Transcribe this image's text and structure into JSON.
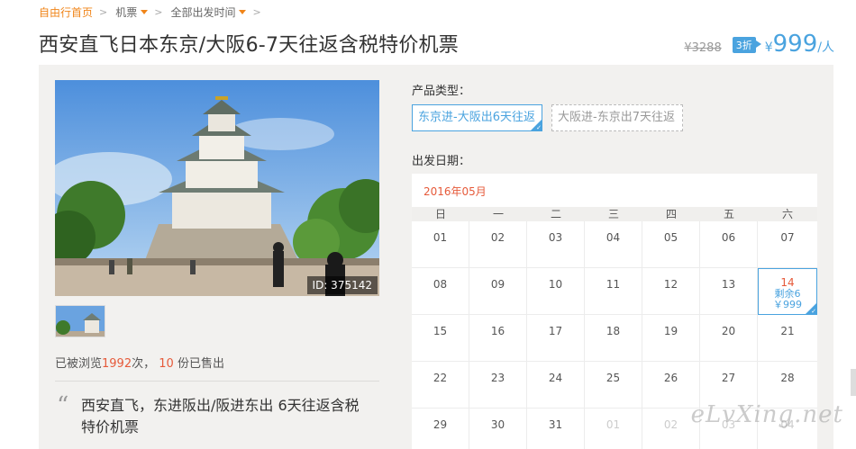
{
  "breadcrumb": {
    "home": "自由行首页",
    "category": "机票",
    "departure_time": "全部出发时间",
    "separator": ">"
  },
  "title": "西安直飞日本东京/大阪6-7天往返含税特价机票",
  "price": {
    "original": "¥3288",
    "discount": "3折",
    "currency": "¥",
    "amount": "999",
    "unit": "/人"
  },
  "gallery": {
    "photo_id": "ID: 375142"
  },
  "stats": {
    "prefix": "已被浏览",
    "views": "1992",
    "mid": "次，",
    "sold": "10",
    "suffix": "份已售出"
  },
  "summary": "西安直飞，东进阪出/阪进东出 6天往返含税特价机票",
  "product_type": {
    "label": "产品类型：",
    "options": [
      {
        "label": "东京进-大阪出6天往返",
        "selected": true
      },
      {
        "label": "大阪进-东京出7天往返",
        "selected": false
      }
    ]
  },
  "departure": {
    "label": "出发日期："
  },
  "calendar": {
    "month": "2016年05月",
    "weekdays": [
      "日",
      "一",
      "二",
      "三",
      "四",
      "五",
      "六"
    ],
    "weeks": [
      [
        "01",
        "02",
        "03",
        "04",
        "05",
        "06",
        "07"
      ],
      [
        "08",
        "09",
        "10",
        "11",
        "12",
        "13",
        "14"
      ],
      [
        "15",
        "16",
        "17",
        "18",
        "19",
        "20",
        "21"
      ],
      [
        "22",
        "23",
        "24",
        "25",
        "26",
        "27",
        "28"
      ],
      [
        "29",
        "30",
        "31",
        "01",
        "02",
        "03",
        "04"
      ]
    ],
    "selected_day": {
      "day": "14",
      "remaining": "剩余6",
      "price": "￥999"
    }
  },
  "watermark": "eLvXing.net",
  "colors": {
    "accent": "#4aa3df",
    "highlight": "#e65a3a",
    "breadcrumb_home": "#f08519",
    "panel_bg": "#f2f1ef"
  }
}
